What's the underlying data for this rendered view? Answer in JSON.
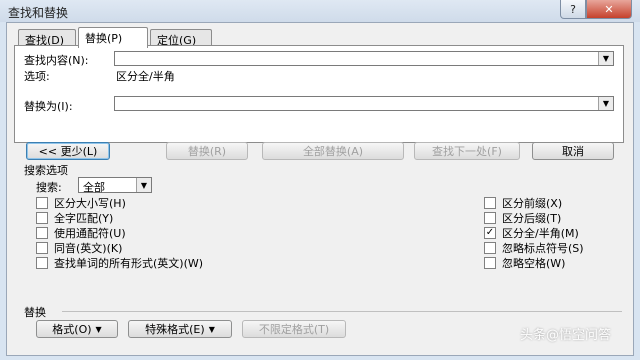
{
  "window": {
    "title": "查找和替换",
    "help_glyph": "?",
    "close_glyph": "✕"
  },
  "tabs": [
    {
      "label": "查找(D)"
    },
    {
      "label": "替换(P)"
    },
    {
      "label": "定位(G)"
    }
  ],
  "find": {
    "label": "查找内容(N):",
    "value": ""
  },
  "options": {
    "label": "选项:",
    "value": "区分全/半角"
  },
  "replace": {
    "label": "替换为(I):",
    "value": ""
  },
  "buttons": {
    "less": "<< 更少(L)",
    "replace": "替换(R)",
    "replace_all": "全部替换(A)",
    "find_next": "查找下一处(F)",
    "cancel": "取消"
  },
  "search_options": {
    "heading": "搜索选项",
    "search_label": "搜索:",
    "search_value": "全部",
    "left": [
      {
        "label": "区分大小写(H)",
        "checked": false
      },
      {
        "label": "全字匹配(Y)",
        "checked": false
      },
      {
        "label": "使用通配符(U)",
        "checked": false
      },
      {
        "label": "同音(英文)(K)",
        "checked": false
      },
      {
        "label": "查找单词的所有形式(英文)(W)",
        "checked": false
      }
    ],
    "right": [
      {
        "label": "区分前缀(X)",
        "checked": false
      },
      {
        "label": "区分后缀(T)",
        "checked": false
      },
      {
        "label": "区分全/半角(M)",
        "checked": true
      },
      {
        "label": "忽略标点符号(S)",
        "checked": false
      },
      {
        "label": "忽略空格(W)",
        "checked": false
      }
    ]
  },
  "replace_section": {
    "heading": "替换",
    "format": "格式(O)",
    "special": "特殊格式(E)",
    "no_format": "不限定格式(T)"
  },
  "watermark": "头条@悟空问答"
}
